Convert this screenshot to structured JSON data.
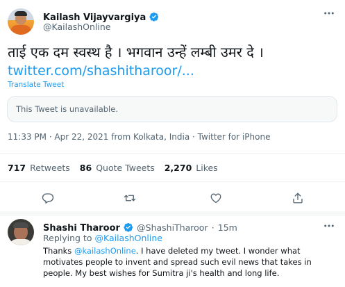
{
  "tweet": {
    "author_name": "Kailash Vijayvargiya",
    "author_handle": "@KailashOnline",
    "text_hindi": "ताई एक दम स्वस्थ है । भगवान उन्हें लम्बी उमर दे ।",
    "link_text": "twitter.com/shashitharoor/...",
    "translate_label": "Translate Tweet",
    "quoted_unavailable": "This Tweet is unavailable.",
    "meta_line": "11:33 PM · Apr 22, 2021 from Kolkata, India · Twitter for iPhone",
    "stats": {
      "retweets_count": "717",
      "retweets_label": "Retweets",
      "quotes_count": "86",
      "quotes_label": "Quote Tweets",
      "likes_count": "2,270",
      "likes_label": "Likes"
    },
    "more_icon": "more-horizontal-icon",
    "actions": [
      "reply-icon",
      "retweet-icon",
      "like-icon",
      "share-icon"
    ]
  },
  "reply": {
    "author_name": "Shashi Tharoor",
    "author_handle": "@ShashiTharoor",
    "separator": "·",
    "time": "15m",
    "replying_prefix": "Replying to",
    "replying_handle": "@KailashOnline",
    "text_thanks": "Thanks",
    "text_mention": "@kailashOnline",
    "text_body": ". I have deleted my tweet. I wonder what motivates people to invent and spread such evil news that takes in people. My best wishes for Sumitra ji's health and long life."
  },
  "colors": {
    "accent": "#1d9bf0",
    "muted": "#536471",
    "text": "#0f1419",
    "border": "#eff3f4"
  }
}
